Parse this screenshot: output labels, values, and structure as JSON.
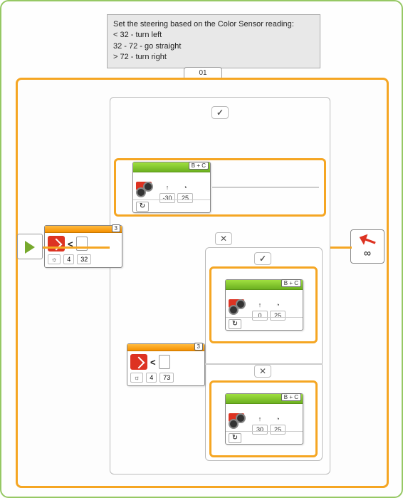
{
  "comment": {
    "title": "Set the steering based on the Color Sensor reading:",
    "line1": "< 32 - turn left",
    "line2": "32 - 72 - go straight",
    "line3": "> 72 - turn right"
  },
  "loop": {
    "label": "01",
    "mode_icon": "infinity",
    "mode": "∞"
  },
  "switch_outer": {
    "port": "3",
    "operator": "<",
    "op_index": "4",
    "threshold": "32",
    "case_true": "✓",
    "case_false": "✕"
  },
  "move1": {
    "ports": "B + C",
    "steering": "-30",
    "power": "25",
    "mode": "rotations",
    "mode_icon": "↻"
  },
  "switch_inner": {
    "port": "3",
    "operator": "<",
    "op_index": "4",
    "threshold": "73",
    "case_true": "✓",
    "case_false": "✕"
  },
  "move2": {
    "ports": "B + C",
    "steering": "0",
    "power": "25",
    "mode": "rotations",
    "mode_icon": "↻"
  },
  "move3": {
    "ports": "B + C",
    "steering": "30",
    "power": "25",
    "mode": "rotations",
    "mode_icon": "↻"
  },
  "icons": {
    "steer_arrow": "↑",
    "gauge": "◔",
    "light": "☼"
  }
}
